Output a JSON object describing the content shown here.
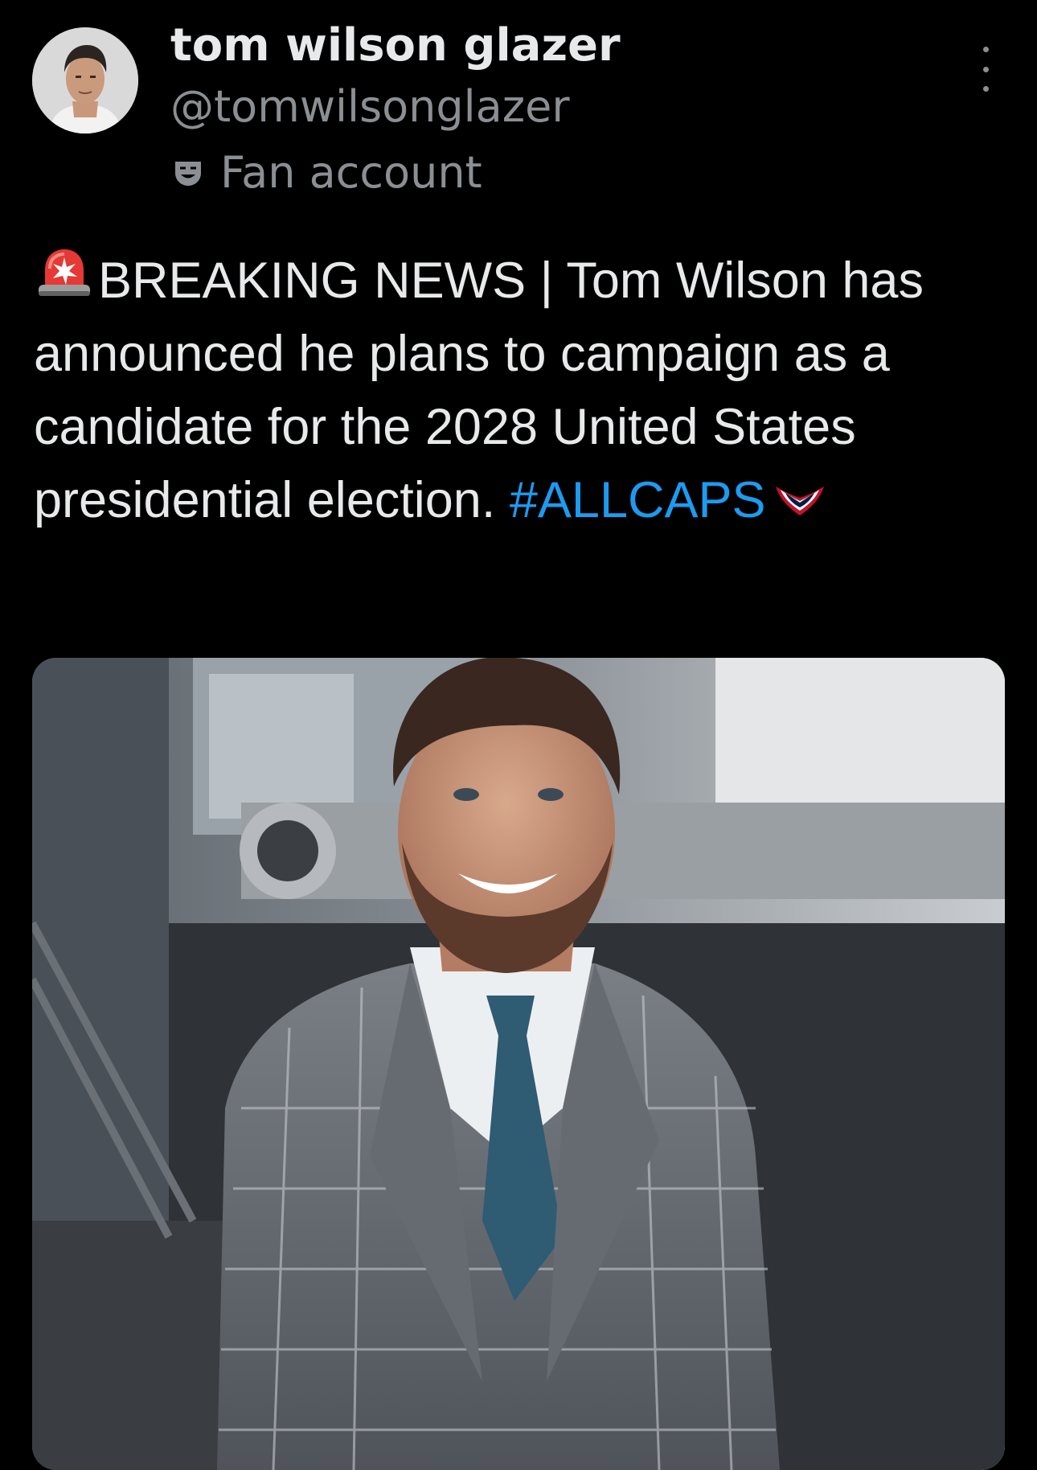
{
  "author": {
    "display_name": "tom wilson glazer",
    "handle": "@tomwilsonglazer",
    "badge_label": "Fan account",
    "badge_icon": "masks-icon",
    "avatar_icon": "profile-photo"
  },
  "tweet": {
    "emoji_icon": "police-light-icon",
    "text_line_1": "BREAKING NEWS | Tom Wilson",
    "text_rest": "has announced he plans to campaign as a candidate for the 2028 United States presidential election.",
    "hashtag": "#ALLCAPS",
    "trailing_icon": "capitals-logo-icon",
    "hashtag_color": "#1d9bf0"
  },
  "menu": {
    "icon": "more-vertical-icon"
  },
  "media": {
    "description_icon": "photo-man-in-plaid-suit"
  }
}
